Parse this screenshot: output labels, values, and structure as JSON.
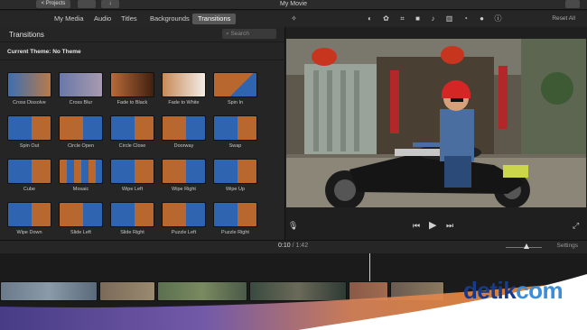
{
  "titlebar": {
    "back_label": "< Projects",
    "title": "My Movie"
  },
  "tabs": [
    {
      "label": "My Media",
      "active": false
    },
    {
      "label": "Audio",
      "active": false
    },
    {
      "label": "Titles",
      "active": false
    },
    {
      "label": "Backgrounds",
      "active": false
    },
    {
      "label": "Transitions",
      "active": true
    }
  ],
  "browser": {
    "title": "Transitions",
    "search_placeholder": "Search",
    "theme_label": "Current Theme: No Theme",
    "transitions": [
      "Cross Dissolve",
      "Cross Blur",
      "Fade to Black",
      "Fade to White",
      "Spin In",
      "Spin Out",
      "Circle Open",
      "Circle Close",
      "Doorway",
      "Swap",
      "Cube",
      "Mosaic",
      "Wipe Left",
      "Wipe Right",
      "Wipe Up",
      "Wipe Down",
      "Slide Left",
      "Slide Right",
      "Puzzle Left",
      "Puzzle Right"
    ]
  },
  "viewer": {
    "reset_label": "Reset All"
  },
  "timeline": {
    "current_time": "0:10",
    "total_time": "/ 1:42",
    "settings_label": "Settings"
  },
  "watermark": {
    "part1": "detik",
    "part2": "com"
  },
  "colors": {
    "tab_active": "#575757",
    "logo_dark": "#173a8a",
    "logo_light": "#3a8dd8",
    "swoosh_orange": "#f08a2c"
  }
}
